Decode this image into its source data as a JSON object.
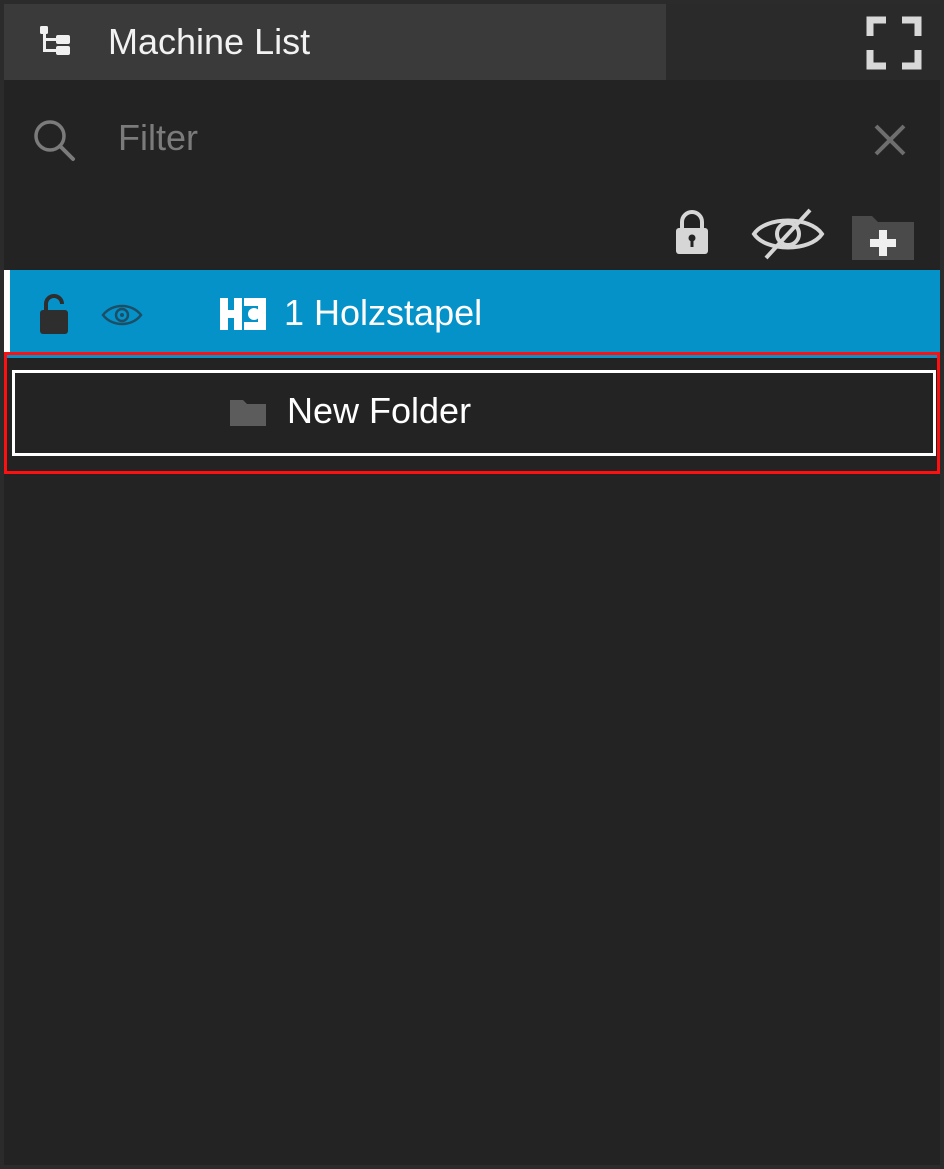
{
  "titlebar": {
    "title": "Machine List",
    "title_icon": "tree-structure-icon",
    "fullscreen_icon": "fullscreen-icon"
  },
  "filter": {
    "placeholder": "Filter",
    "value": "",
    "search_icon": "search-icon",
    "clear_icon": "close-icon"
  },
  "toolbar": {
    "lock_icon": "lock-icon",
    "visibility_icon": "eye-slash-icon",
    "add_folder_icon": "folder-plus-icon"
  },
  "list": {
    "items": [
      {
        "label": "1 Holzstapel",
        "type": "machine",
        "selected": true,
        "lock_icon": "lock-icon",
        "visibility_icon": "eye-icon",
        "logo_icon": "hc-logo-icon"
      },
      {
        "label": "New Folder",
        "type": "folder",
        "selected": false,
        "editing": true,
        "folder_icon": "folder-icon"
      }
    ]
  },
  "colors": {
    "panel_bg": "#232323",
    "title_tab_bg": "#3a3a3a",
    "selection_blue": "#0592c9",
    "highlight_red": "#ff1010",
    "text_primary": "#ffffff",
    "text_placeholder": "#7b7b7b"
  }
}
